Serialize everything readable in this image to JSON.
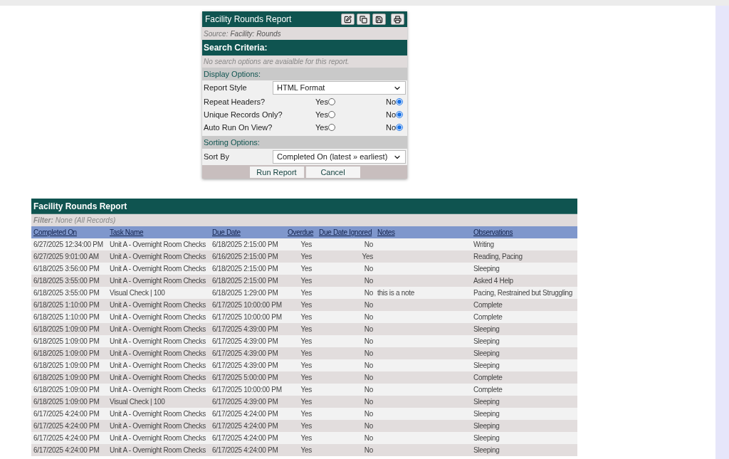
{
  "form": {
    "title": "Facility Rounds Report",
    "source_label": "Source:",
    "source": "Facility: Rounds",
    "search_header": "Search Criteria:",
    "search_note": "No search options are avaialble for this report.",
    "display_header": "Display Options:",
    "report_style": {
      "label": "Report Style",
      "value": "HTML Format"
    },
    "options": [
      {
        "label": "Repeat Headers?",
        "choices": [
          {
            "label": "Yes",
            "selected": false
          },
          {
            "label": "No",
            "selected": true
          }
        ]
      },
      {
        "label": "Unique Records Only?",
        "choices": [
          {
            "label": "Yes",
            "selected": false
          },
          {
            "label": "No",
            "selected": true
          }
        ]
      },
      {
        "label": "Auto Run On View?",
        "choices": [
          {
            "label": "Yes",
            "selected": false
          },
          {
            "label": "No",
            "selected": true
          }
        ]
      }
    ],
    "sorting_header": "Sorting Options:",
    "sort_by": {
      "label": "Sort By",
      "value": "Completed On (latest » earliest)"
    },
    "buttons": [
      "Run Report",
      "Cancel"
    ]
  },
  "report": {
    "title": "Facility Rounds Report",
    "filter_label": "Filter:",
    "filter": "None (All Records)",
    "columns": [
      "Completed On",
      "Task Name",
      "Due Date",
      "Overdue",
      "Due Date Ignored",
      "Notes",
      "Observations"
    ],
    "rows": [
      [
        "6/27/2025 12:34:00 PM",
        "Unit A - Overnight Room Checks",
        "6/18/2025 2:15:00 PM",
        "Yes",
        "No",
        "",
        "Writing"
      ],
      [
        "6/27/2025 9:01:00 AM",
        "Unit A - Overnight Room Checks",
        "6/16/2025 2:15:00 PM",
        "Yes",
        "Yes",
        "",
        "Reading, Pacing"
      ],
      [
        "6/18/2025 3:56:00 PM",
        "Unit A - Overnight Room Checks",
        "6/18/2025 2:15:00 PM",
        "Yes",
        "No",
        "",
        "Sleeping"
      ],
      [
        "6/18/2025 3:55:00 PM",
        "Unit A - Overnight Room Checks",
        "6/18/2025 2:15:00 PM",
        "Yes",
        "No",
        "",
        "Asked 4 Help"
      ],
      [
        "6/18/2025 3:55:00 PM",
        "Visual Check | 100",
        "6/18/2025 1:29:00 PM",
        "Yes",
        "No",
        "this is a note",
        "Pacing, Restrained but Struggling"
      ],
      [
        "6/18/2025 1:10:00 PM",
        "Unit A - Overnight Room Checks",
        "6/17/2025 10:00:00 PM",
        "Yes",
        "No",
        "",
        "Complete"
      ],
      [
        "6/18/2025 1:10:00 PM",
        "Unit A - Overnight Room Checks",
        "6/17/2025 10:00:00 PM",
        "Yes",
        "No",
        "",
        "Complete"
      ],
      [
        "6/18/2025 1:09:00 PM",
        "Unit A - Overnight Room Checks",
        "6/17/2025 4:39:00 PM",
        "Yes",
        "No",
        "",
        "Sleeping"
      ],
      [
        "6/18/2025 1:09:00 PM",
        "Unit A - Overnight Room Checks",
        "6/17/2025 4:39:00 PM",
        "Yes",
        "No",
        "",
        "Sleeping"
      ],
      [
        "6/18/2025 1:09:00 PM",
        "Unit A - Overnight Room Checks",
        "6/17/2025 4:39:00 PM",
        "Yes",
        "No",
        "",
        "Sleeping"
      ],
      [
        "6/18/2025 1:09:00 PM",
        "Unit A - Overnight Room Checks",
        "6/17/2025 4:39:00 PM",
        "Yes",
        "No",
        "",
        "Sleeping"
      ],
      [
        "6/18/2025 1:09:00 PM",
        "Unit A - Overnight Room Checks",
        "6/17/2025 5:00:00 PM",
        "Yes",
        "No",
        "",
        "Complete"
      ],
      [
        "6/18/2025 1:09:00 PM",
        "Unit A - Overnight Room Checks",
        "6/17/2025 10:00:00 PM",
        "Yes",
        "No",
        "",
        "Complete"
      ],
      [
        "6/18/2025 1:09:00 PM",
        "Visual Check | 100",
        "6/17/2025 4:39:00 PM",
        "Yes",
        "No",
        "",
        "Sleeping"
      ],
      [
        "6/17/2025 4:24:00 PM",
        "Unit A - Overnight Room Checks",
        "6/17/2025 4:24:00 PM",
        "Yes",
        "No",
        "",
        "Sleeping"
      ],
      [
        "6/17/2025 4:24:00 PM",
        "Unit A - Overnight Room Checks",
        "6/17/2025 4:24:00 PM",
        "Yes",
        "No",
        "",
        "Sleeping"
      ],
      [
        "6/17/2025 4:24:00 PM",
        "Unit A - Overnight Room Checks",
        "6/17/2025 4:24:00 PM",
        "Yes",
        "No",
        "",
        "Sleeping"
      ],
      [
        "6/17/2025 4:24:00 PM",
        "Unit A - Overnight Room Checks",
        "6/17/2025 4:24:00 PM",
        "Yes",
        "No",
        "",
        "Sleeping"
      ]
    ]
  }
}
